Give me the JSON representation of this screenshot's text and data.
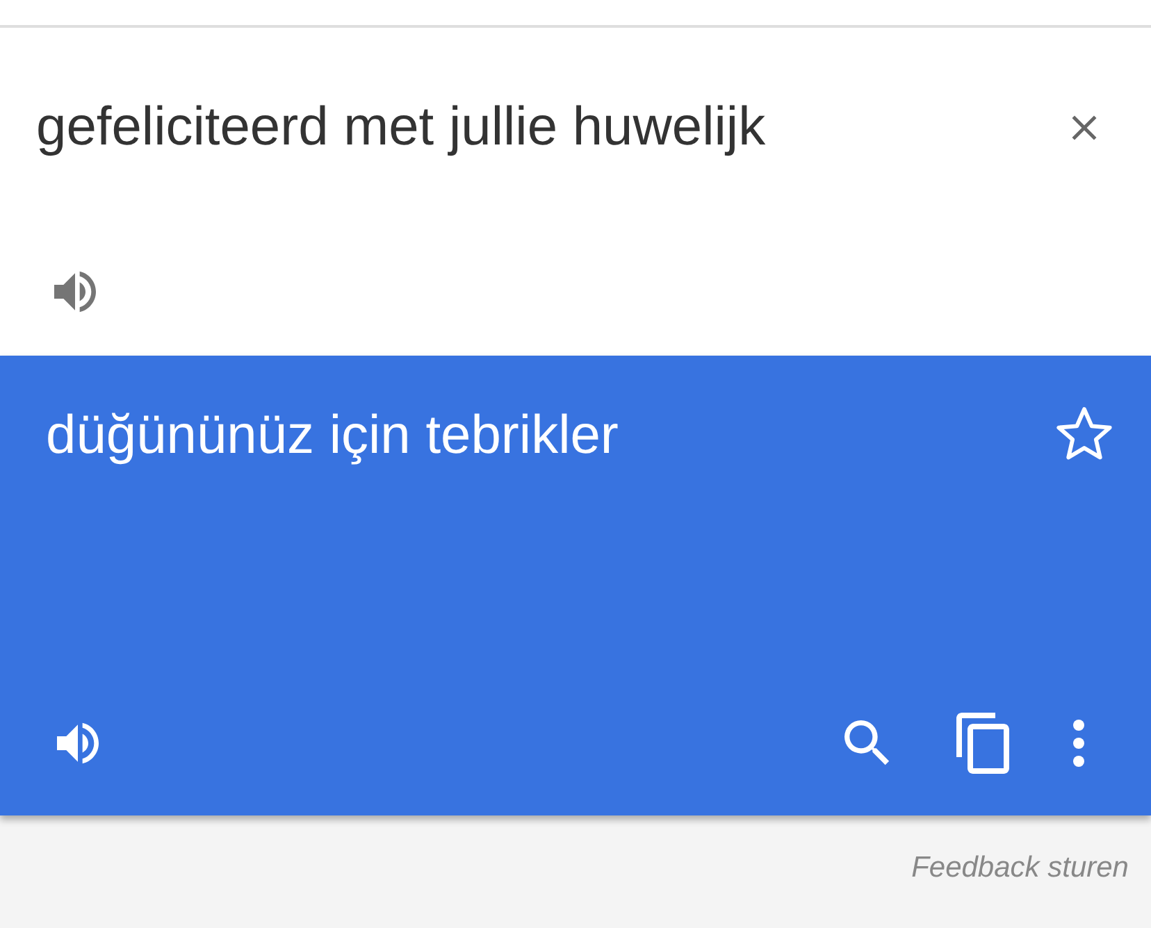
{
  "source": {
    "text": "gefeliciteerd met jullie huwelijk"
  },
  "translation": {
    "text": "düğününüz için tebrikler",
    "starred": false
  },
  "footer": {
    "link": "Feedback sturen"
  }
}
